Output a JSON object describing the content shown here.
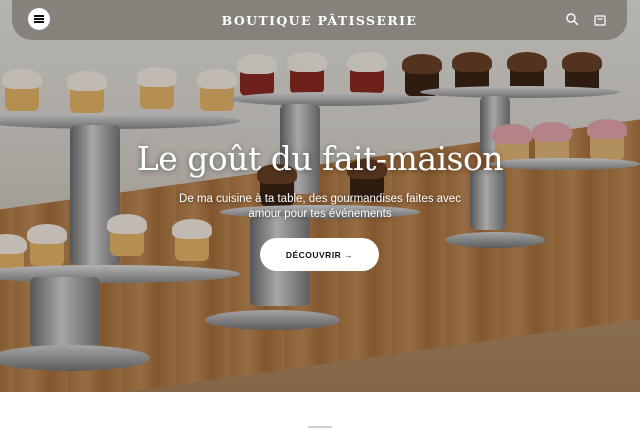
{
  "header": {
    "brand": "BOUTIQUE PÂTISSERIE",
    "menu_icon": "hamburger-menu-icon",
    "search_icon": "search-icon",
    "cart_icon": "shopping-bag-icon"
  },
  "hero": {
    "title": "Le goût du fait-maison",
    "subtitle": "De ma cuisine à ta table, des gourmandises faites avec amour pour tes événements",
    "cta_label": "DÉCOUVRIR →",
    "image": "cupcakes-on-stands-photo"
  },
  "colors": {
    "header_background": "#7d7870",
    "text_on_hero": "#ffffff",
    "button_background": "#ffffff"
  }
}
